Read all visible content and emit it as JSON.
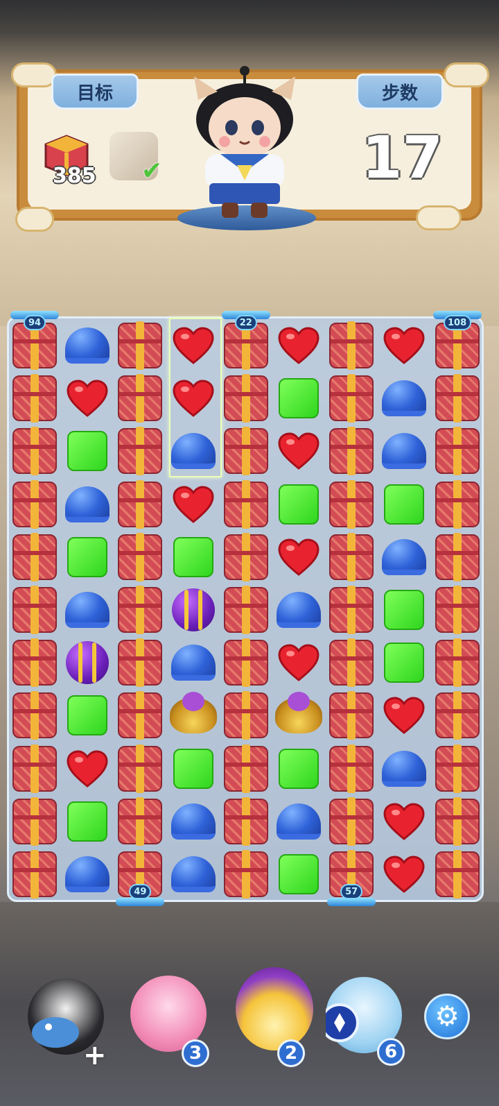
{
  "header": {
    "goal_tab": "目标",
    "moves_tab": "步数",
    "moves_left": "17",
    "goals": [
      {
        "icon": "red-chest-icon",
        "count": "385"
      },
      {
        "icon": "stone-tile-icon",
        "done": true
      }
    ]
  },
  "board": {
    "column_counters": [
      {
        "col": 0,
        "value": "94",
        "pos": "top"
      },
      {
        "col": 4,
        "value": "22",
        "pos": "top"
      },
      {
        "col": 8,
        "value": "108",
        "pos": "top"
      },
      {
        "col": 2,
        "value": "49",
        "pos": "bottom"
      },
      {
        "col": 6,
        "value": "57",
        "pos": "bottom"
      }
    ],
    "grid": [
      [
        "chest",
        "hat",
        "chest",
        "heart",
        "chest",
        "heart",
        "chest",
        "heart",
        "chest"
      ],
      [
        "chest",
        "heart",
        "chest",
        "heart",
        "chest",
        "block",
        "chest",
        "hat",
        "chest"
      ],
      [
        "chest",
        "block",
        "chest",
        "hat",
        "chest",
        "heart",
        "chest",
        "hat",
        "chest"
      ],
      [
        "chest",
        "hat",
        "chest",
        "heart",
        "chest",
        "block",
        "chest",
        "block",
        "chest"
      ],
      [
        "chest",
        "block",
        "chest",
        "block",
        "chest",
        "heart",
        "chest",
        "hat",
        "chest"
      ],
      [
        "chest",
        "hat",
        "chest",
        "ball",
        "chest",
        "hat",
        "chest",
        "block",
        "chest"
      ],
      [
        "chest",
        "ball",
        "chest",
        "hat",
        "chest",
        "heart",
        "chest",
        "block",
        "chest"
      ],
      [
        "chest",
        "block",
        "chest",
        "ufo",
        "chest",
        "ufo",
        "chest",
        "heart",
        "chest"
      ],
      [
        "chest",
        "heart",
        "chest",
        "block",
        "chest",
        "block",
        "chest",
        "hat",
        "chest"
      ],
      [
        "chest",
        "block",
        "chest",
        "hat",
        "chest",
        "hat",
        "chest",
        "heart",
        "chest"
      ],
      [
        "chest",
        "hat",
        "chest",
        "hat",
        "chest",
        "block",
        "chest",
        "heart",
        "chest"
      ]
    ]
  },
  "boosters": [
    {
      "name": "panda-whale-booster",
      "badge": "+"
    },
    {
      "name": "pink-hero-booster",
      "badge": "3"
    },
    {
      "name": "purple-ball-hero-booster",
      "badge": "2"
    },
    {
      "name": "blue-hero-booster",
      "badge": "6"
    }
  ],
  "settings_icon": "gear-icon"
}
